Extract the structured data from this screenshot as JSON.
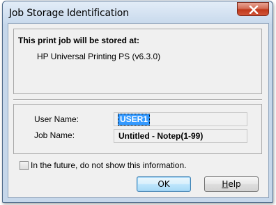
{
  "window": {
    "title": "Job Storage Identification",
    "close_glyph": "X"
  },
  "info": {
    "heading": "This print job will be stored at:",
    "printer": "HP Universal Printing PS (v6.3.0)"
  },
  "fields": {
    "user_name_label": "User Name:",
    "user_name_value": "USER1",
    "job_name_label": "Job Name:",
    "job_name_value": "Untitled - Notep(1-99)"
  },
  "options": {
    "dont_show_label": "In the future, do not show this information.",
    "dont_show_checked": false
  },
  "buttons": {
    "ok_label": "OK",
    "help_access_key": "H",
    "help_rest": "elp"
  },
  "colors": {
    "selection": "#3399ff",
    "close_button": "#c0391b"
  }
}
